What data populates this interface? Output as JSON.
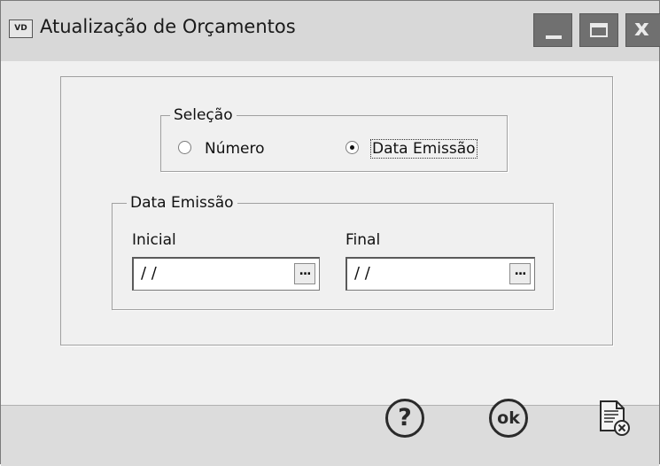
{
  "window": {
    "app_icon_text": "VD",
    "title": "Atualização de Orçamentos",
    "controls": {
      "minimize_icon": "minimize-icon",
      "maximize_icon": "maximize-icon",
      "close_icon": "close-icon",
      "close_glyph": "x"
    }
  },
  "selection": {
    "legend": "Seleção",
    "options": [
      {
        "label": "Número",
        "checked": false
      },
      {
        "label": "Data Emissão",
        "checked": true
      }
    ]
  },
  "date_filter": {
    "legend": "Data Emissão",
    "initial": {
      "label": "Inicial",
      "value": " / /",
      "button_label": "..."
    },
    "final": {
      "label": "Final",
      "value": " / /",
      "button_label": "..."
    }
  },
  "footer": {
    "help_label": "?",
    "ok_label": "ok",
    "icons": {
      "help": "help-icon",
      "ok": "ok-icon",
      "cancel": "cancel-document-icon"
    }
  },
  "colors": {
    "titlebar": "#d8d8d8",
    "window_buttons": "#707070",
    "body": "#f0f0f0",
    "footer": "#dcdcdc"
  }
}
